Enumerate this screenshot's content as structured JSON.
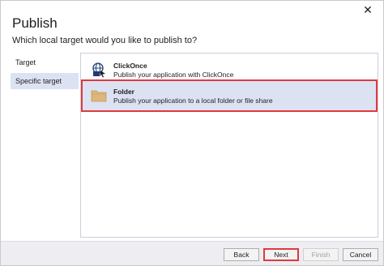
{
  "window": {
    "title": "Publish",
    "subtitle": "Which local target would you like to publish to?",
    "close_glyph": "✕"
  },
  "nav": {
    "items": [
      {
        "label": "Target",
        "selected": false
      },
      {
        "label": "Specific target",
        "selected": true
      }
    ]
  },
  "options": {
    "clickonce": {
      "title": "ClickOnce",
      "description": "Publish your application with ClickOnce",
      "icon": "clickonce-globe-icon"
    },
    "folder": {
      "title": "Folder",
      "description": "Publish your application to a local folder or file share",
      "icon": "folder-icon",
      "selected": true
    }
  },
  "footer": {
    "back_label": "Back",
    "next_label": "Next",
    "finish_label": "Finish",
    "finish_disabled": true,
    "cancel_label": "Cancel"
  },
  "colors": {
    "selection": "#dde2f3",
    "highlight_border": "#e0393e",
    "footer_bg": "#eeeef2",
    "folder_color": "#dcb67a"
  }
}
